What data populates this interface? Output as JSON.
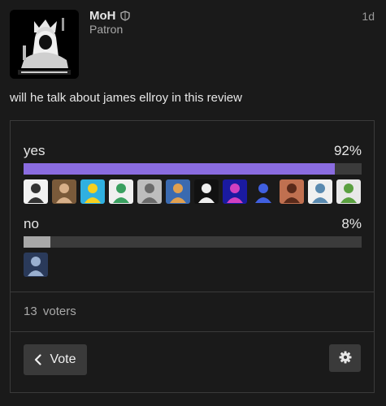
{
  "post": {
    "username": "MoH",
    "user_title": "Patron",
    "date": "1d",
    "text": "will he talk about james ellroy in this review",
    "avatar_icon": "black-white-figure-avatar"
  },
  "poll": {
    "options": [
      {
        "label": "yes",
        "percent_label": "92%",
        "percent": 92,
        "color": "#8a6ce0",
        "voter_avatars": [
          {
            "bg": "#f2f2f2",
            "fg": "#333333"
          },
          {
            "bg": "#7a5a3a",
            "fg": "#d8b08a"
          },
          {
            "bg": "#30b0e0",
            "fg": "#f5d020"
          },
          {
            "bg": "#f0f0f0",
            "fg": "#3aa060"
          },
          {
            "bg": "#bdbdbd",
            "fg": "#6a6a6a"
          },
          {
            "bg": "#3a6ab0",
            "fg": "#e0a050"
          },
          {
            "bg": "#111111",
            "fg": "#eeeeee"
          },
          {
            "bg": "#1a1aa0",
            "fg": "#d040c0"
          },
          {
            "bg": "#1a1a1a",
            "fg": "#4060e0"
          },
          {
            "bg": "#c07050",
            "fg": "#5a2a1a"
          },
          {
            "bg": "#f0f0f0",
            "fg": "#5a8ab0"
          },
          {
            "bg": "#e8e8e8",
            "fg": "#5aa040"
          }
        ]
      },
      {
        "label": "no",
        "percent_label": "8%",
        "percent": 8,
        "color": "#a8a8a8",
        "voter_avatars": [
          {
            "bg": "#2a3a5a",
            "fg": "#9ab0d0"
          }
        ]
      }
    ],
    "voters_count": "13",
    "voters_label": "voters",
    "vote_button_label": "Vote",
    "vote_button_icon": "chevron-left-icon",
    "settings_icon": "gear-icon"
  }
}
